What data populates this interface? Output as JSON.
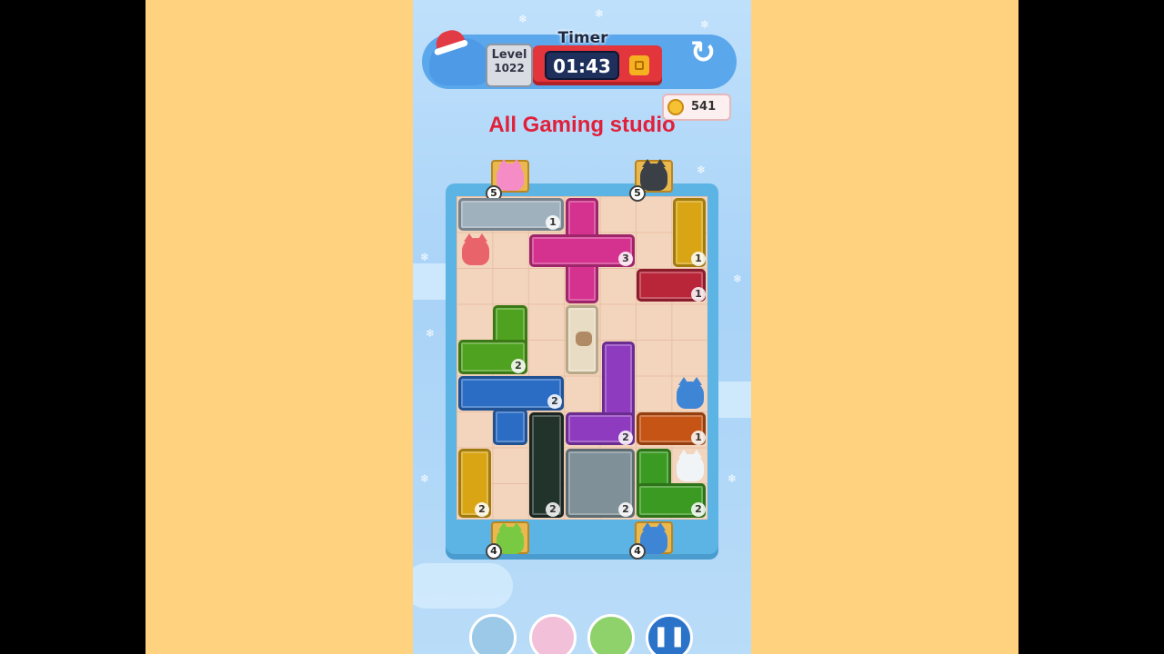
{
  "header": {
    "level_label": "Level",
    "level_number": "1022",
    "timer_label": "Timer",
    "timer_value": "01:43",
    "coins": "541"
  },
  "watermark": "All Gaming studio",
  "board": {
    "gates": [
      {
        "name": "pink-cat-gate",
        "count": "5"
      },
      {
        "name": "black-cat-gate",
        "count": "5"
      },
      {
        "name": "green-cat-gate",
        "count": "4"
      },
      {
        "name": "blue-cat-gate",
        "count": "4"
      }
    ],
    "blocks": [
      {
        "name": "gray-bar-block",
        "count": "1"
      },
      {
        "name": "magenta-plus-block",
        "count": "3"
      },
      {
        "name": "yellow-vertical-block",
        "count": "1"
      },
      {
        "name": "red-bar-block",
        "count": "1"
      },
      {
        "name": "green-l-block",
        "count": "2"
      },
      {
        "name": "blue-t-block",
        "count": "2"
      },
      {
        "name": "purple-l-block",
        "count": "2"
      },
      {
        "name": "orange-bar-block",
        "count": "1"
      },
      {
        "name": "yellow-small-block",
        "count": "2"
      },
      {
        "name": "dark-green-block",
        "count": "2"
      },
      {
        "name": "gray-square-block",
        "count": "2"
      },
      {
        "name": "lime-l-block",
        "count": "2"
      }
    ]
  },
  "colors": {
    "side_background": "#ffd27f",
    "board_frame": "#5bb4e4",
    "timer_bar": "#e2353c",
    "watermark": "#e0203a"
  }
}
